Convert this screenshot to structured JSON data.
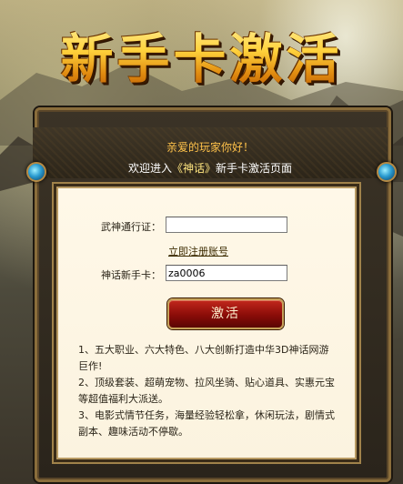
{
  "title": "新手卡激活",
  "greeting": "亲爱的玩家你好！",
  "welcome": {
    "prefix": "欢迎进入",
    "game": "《神话》",
    "suffix": "新手卡激活页面"
  },
  "form": {
    "account_label": "武神通行证：",
    "account_value": "",
    "register_link": "立即注册账号",
    "card_label": "神话新手卡：",
    "card_value": "za0006",
    "activate_label": "激活"
  },
  "notes": [
    "1、五大职业、六大特色、八大创新打造中华3D神话网游巨作!",
    "2、顶级套装、超萌宠物、拉风坐骑、贴心道具、实惠元宝等超值福利大派送。",
    "3、电影式情节任务，海量经验轻松拿，休闲玩法，剧情式副本、趣味活动不停歇。"
  ],
  "colors": {
    "title_gold": "#ffd24a",
    "greeting": "#ffc24a",
    "button_red": "#a0140d",
    "panel_bg": "#fff8e8"
  }
}
